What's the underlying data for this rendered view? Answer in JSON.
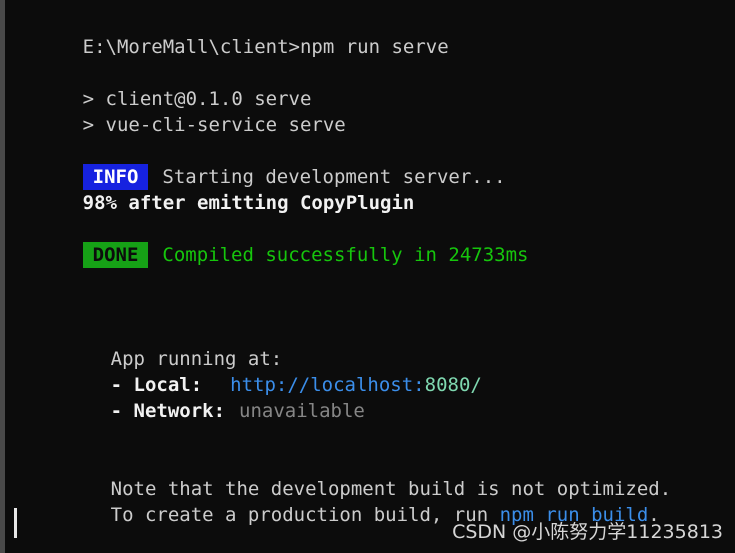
{
  "terminal": {
    "background_color": "#0c0c0c",
    "default_text_color": "#cccccc",
    "gutter_color": "#4a4a4a",
    "prompt_line": "E:\\MoreMall\\client>npm run serve",
    "npm_script_line": "> client@0.1.0 serve",
    "npm_command_line": "> vue-cli-service serve",
    "info_badge": "INFO",
    "info_badge_bg": "#1622e0",
    "info_message": "Starting development server...",
    "progress_line": "98% after emitting CopyPlugin",
    "done_badge": "DONE",
    "done_badge_bg": "#16a116",
    "done_message": "Compiled successfully in 24733ms",
    "done_message_color": "#16c60c",
    "app_running_label": "App running at:",
    "local_label": "- Local:",
    "local_url_base": "http://localhost:",
    "local_url_port": "8080/",
    "local_url_color": "#3b8eea",
    "local_port_color": "#7fd8b0",
    "network_label": "- Network:",
    "network_value": "unavailable",
    "network_value_color": "#868686",
    "note_line": "Note that the development build is not optimized.",
    "production_prefix": "To create a production build, run ",
    "production_command": "npm run build",
    "production_suffix": "."
  },
  "watermark": {
    "text": "CSDN @小陈努力学11235813"
  }
}
